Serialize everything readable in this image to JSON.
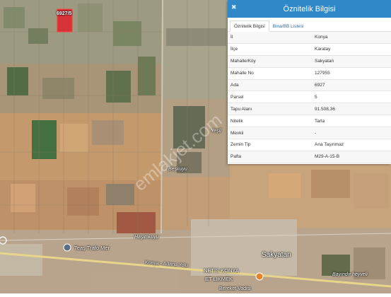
{
  "map": {
    "labels": {
      "parcel": "6927/5",
      "beskuyu": "Beşkuyu",
      "hasimkuyu": "Haşimkuyu",
      "teas": "Teaş Trafo Mer",
      "road": "Konya - Adana Yolu",
      "netis": "NETIS KONYA",
      "etlik": "ET LIKMEK",
      "sakyatan": "Sakyatan",
      "bereket": "Bereket Vadisi",
      "bayindir": "Bayındır heyveli",
      "watermark": "emlakjet.com",
      "yesil": "Yeşil"
    },
    "colors": {
      "parcel": "#e0202a",
      "accent": "#2f88c8"
    }
  },
  "panel": {
    "title": "Öznitelik Bilgisi",
    "close_icon": "close-icon",
    "tabs": [
      {
        "label": "Öznitelik Bilgisi",
        "active": true
      },
      {
        "label": "Bina/BB Listesi",
        "active": false
      }
    ],
    "rows": [
      {
        "key": "İl",
        "value": "Konya"
      },
      {
        "key": "İlçe",
        "value": "Karatay"
      },
      {
        "key": "Mahalle/Köy",
        "value": "Sakyatan"
      },
      {
        "key": "Mahalle No",
        "value": "127955"
      },
      {
        "key": "Ada",
        "value": "6927"
      },
      {
        "key": "Parsel",
        "value": "5"
      },
      {
        "key": "Tapu Alanı",
        "value": "91.508,36"
      },
      {
        "key": "Nitelik",
        "value": "Tarla"
      },
      {
        "key": "Mevkii",
        "value": "-"
      },
      {
        "key": "Zemin Tip",
        "value": "Ana Taşınmaz"
      },
      {
        "key": "Pafta",
        "value": "M29-A-15-B"
      }
    ]
  }
}
